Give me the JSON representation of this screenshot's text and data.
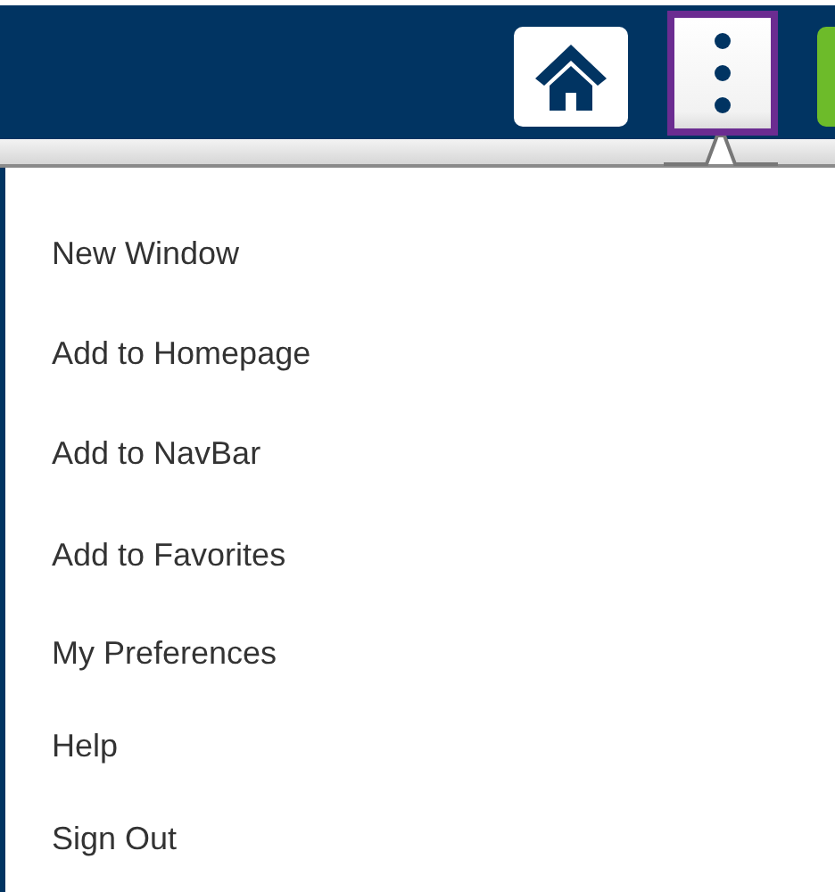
{
  "header": {
    "buttons": [
      {
        "kind": "home",
        "highlighted": false
      },
      {
        "kind": "actions",
        "highlighted": true
      },
      {
        "kind": "partial",
        "highlighted": false
      }
    ]
  },
  "menu": {
    "items": [
      {
        "label": "New Window"
      },
      {
        "label": "Add to Homepage"
      },
      {
        "label": "Add to NavBar"
      },
      {
        "label": "Add to Favorites"
      },
      {
        "label": "My Preferences"
      },
      {
        "label": "Help"
      },
      {
        "label": "Sign Out"
      }
    ]
  }
}
